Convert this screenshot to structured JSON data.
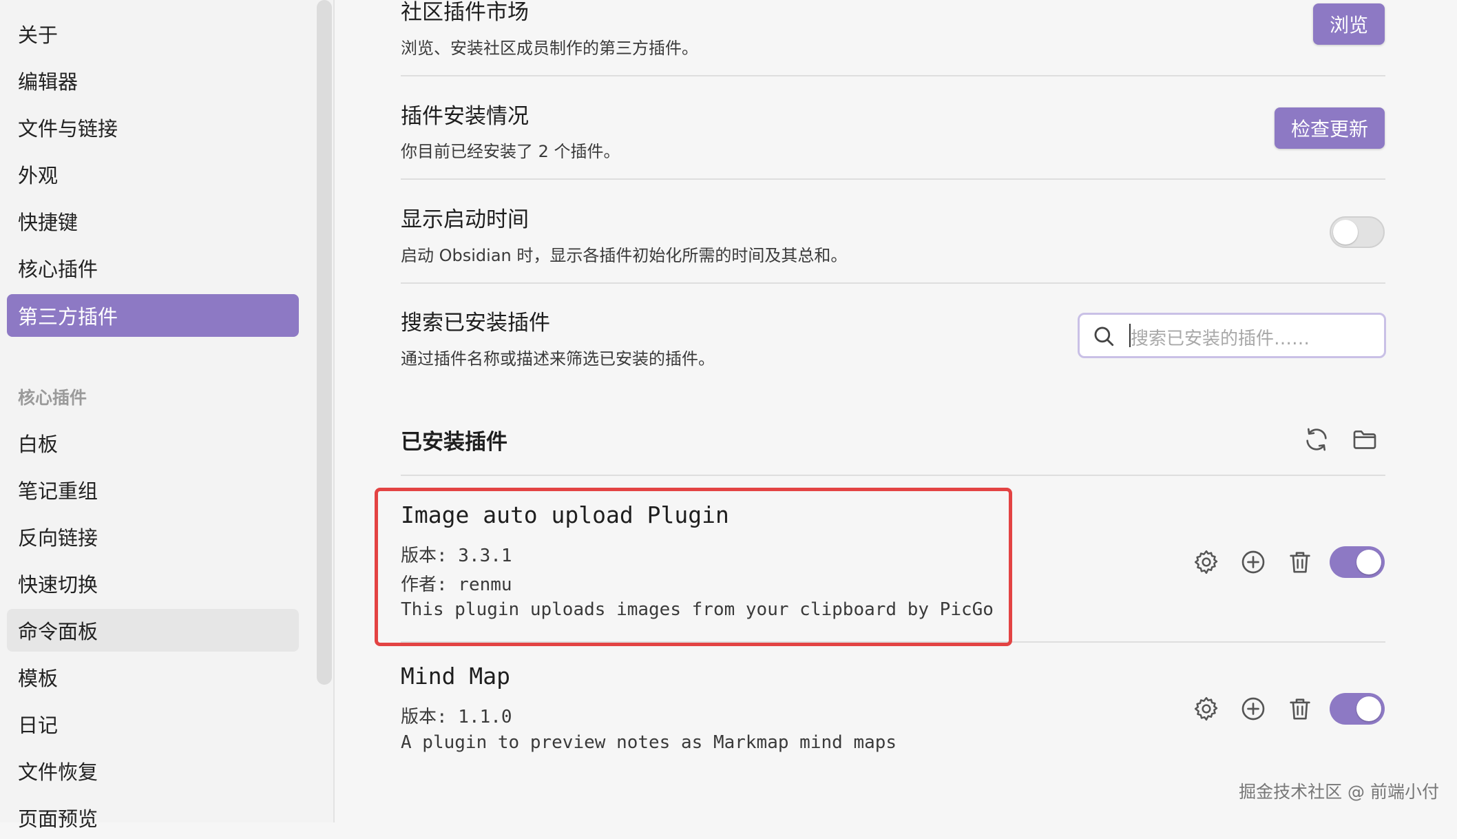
{
  "sidebar": {
    "options_items": [
      {
        "label": "关于"
      },
      {
        "label": "编辑器"
      },
      {
        "label": "文件与链接"
      },
      {
        "label": "外观"
      },
      {
        "label": "快捷键"
      },
      {
        "label": "核心插件"
      },
      {
        "label": "第三方插件",
        "active": true
      }
    ],
    "section_heading": "核心插件",
    "core_items": [
      {
        "label": "白板"
      },
      {
        "label": "笔记重组"
      },
      {
        "label": "反向链接"
      },
      {
        "label": "快速切换"
      },
      {
        "label": "命令面板",
        "hover": true
      },
      {
        "label": "模板"
      },
      {
        "label": "日记"
      },
      {
        "label": "文件恢复"
      },
      {
        "label": "页面预览"
      }
    ]
  },
  "settings": {
    "community": {
      "name": "社区插件市场",
      "desc": "浏览、安装社区成员制作的第三方插件。",
      "button": "浏览"
    },
    "installed_status": {
      "name": "插件安装情况",
      "desc": "你目前已经安装了 2 个插件。",
      "button": "检查更新"
    },
    "startup_time": {
      "name": "显示启动时间",
      "desc": "启动 Obsidian 时，显示各插件初始化所需的时间及其总和。",
      "enabled": false
    },
    "search": {
      "name": "搜索已安装插件",
      "desc": "通过插件名称或描述来筛选已安装的插件。",
      "placeholder": "搜索已安装的插件……"
    }
  },
  "installed": {
    "heading": "已安装插件",
    "plugins": [
      {
        "name": "Image auto upload Plugin",
        "version": "版本: 3.3.1",
        "author": "作者: renmu",
        "description": "This plugin uploads images from your clipboard by PicGo",
        "enabled": true
      },
      {
        "name": "Mind Map",
        "version": "版本: 1.1.0",
        "description": "A plugin to preview notes as Markmap mind maps",
        "enabled": true
      }
    ]
  },
  "icons": {
    "search": "search-icon",
    "reload": "reload-icon",
    "folder": "folder-icon",
    "settings": "gear-icon",
    "add_hotkey": "plus-circle-icon",
    "uninstall": "trash-icon"
  },
  "colors": {
    "accent": "#8d79c4",
    "highlight_border": "#e34343"
  },
  "watermark": "掘金技术社区 @ 前端小付"
}
